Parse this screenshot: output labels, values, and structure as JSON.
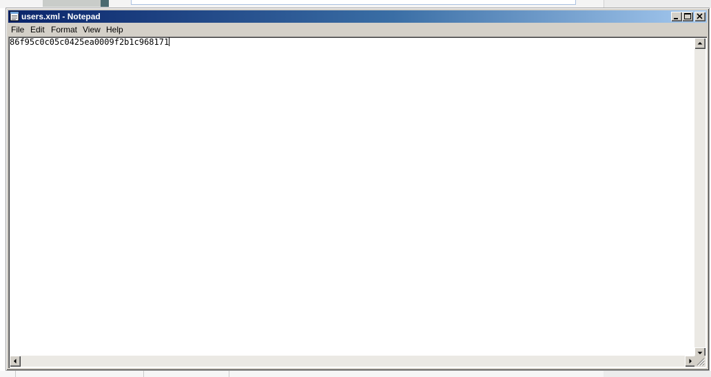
{
  "window": {
    "title": "users.xml - Notepad",
    "title_icon": "notepad-icon",
    "controls": [
      "minimize-icon",
      "maximize-icon",
      "close-icon"
    ]
  },
  "menu": {
    "items": [
      {
        "label": "File"
      },
      {
        "label": "Edit"
      },
      {
        "label": "Format"
      },
      {
        "label": "View"
      },
      {
        "label": "Help"
      }
    ]
  },
  "editor": {
    "content": "86f95c0c05c0425ea0009f2b1c968171"
  },
  "colors": {
    "titlebar_start": "#0a246a",
    "titlebar_end": "#a6caf0",
    "chrome": "#d4d0c8"
  }
}
